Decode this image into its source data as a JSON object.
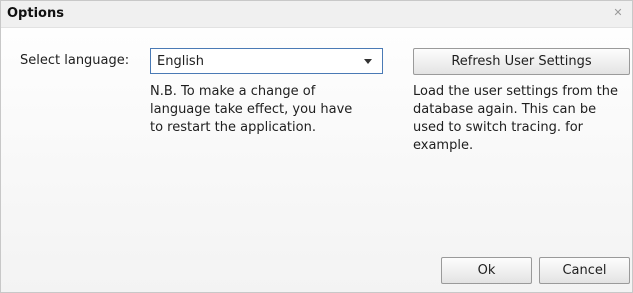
{
  "window": {
    "title": "Options",
    "close_glyph": "✕"
  },
  "language": {
    "label": "Select language:",
    "selected": "English",
    "note": "N.B. To make a change of language take effect, you have to restart the application."
  },
  "refresh": {
    "button_label": "Refresh User Settings",
    "description": "Load the user settings from the database again. This can be used to switch tracing. for example."
  },
  "footer": {
    "ok_label": "Ok",
    "cancel_label": "Cancel"
  },
  "colors": {
    "select_border": "#4a7ab5",
    "button_border": "#9a9a9a",
    "titlebar_bg": "#f0f0f0"
  }
}
